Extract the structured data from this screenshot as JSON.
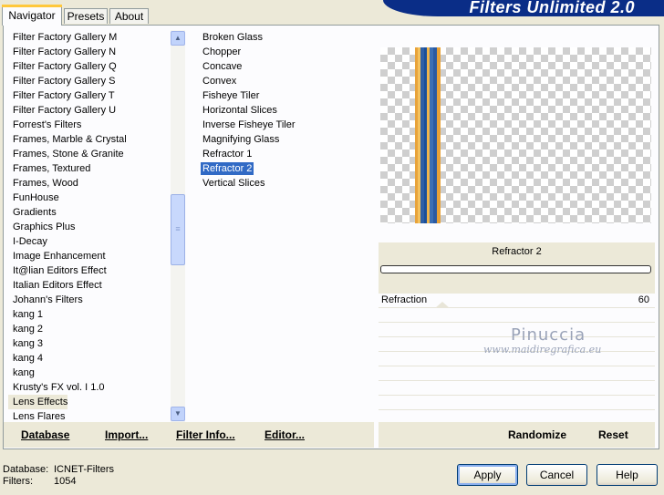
{
  "tabs": [
    "Navigator",
    "Presets",
    "About"
  ],
  "banner_title": "Filters Unlimited 2.0",
  "categories": [
    "Filter Factory Gallery M",
    "Filter Factory Gallery N",
    "Filter Factory Gallery Q",
    "Filter Factory Gallery S",
    "Filter Factory Gallery T",
    "Filter Factory Gallery U",
    "Forrest's Filters",
    "Frames, Marble & Crystal",
    "Frames, Stone & Granite",
    "Frames, Textured",
    "Frames, Wood",
    "FunHouse",
    "Gradients",
    "Graphics Plus",
    "I-Decay",
    "Image Enhancement",
    "It@lian Editors Effect",
    "Italian Editors Effect",
    "Johann's Filters",
    "kang 1",
    "kang 2",
    "kang 3",
    "kang 4",
    "kang",
    "Krusty's FX vol. I 1.0",
    "Lens Effects",
    "Lens Flares"
  ],
  "selected_category": "Lens Effects",
  "filters": [
    "Broken Glass",
    "Chopper",
    "Concave",
    "Convex",
    "Fisheye Tiler",
    "Horizontal Slices",
    "Inverse Fisheye Tiler",
    "Magnifying Glass",
    "Refractor 1",
    "Refractor 2",
    "Vertical Slices"
  ],
  "selected_filter": "Refractor 2",
  "preview": {
    "stripe_colors": [
      "#e8a33a",
      "#f4c25e",
      "#2e5fa6",
      "#1a4f9a",
      "#f0b54c",
      "#3b6fb5",
      "#2a5aa2",
      "#e7a137"
    ]
  },
  "filter_name": "Refractor 2",
  "progress": 0,
  "parameter": {
    "label": "Refraction",
    "value": "60"
  },
  "watermark": {
    "name": "Pinuccia",
    "site": "www.maidiregrafica.eu"
  },
  "left_buttons": {
    "database": "Database",
    "import": "Import...",
    "filter_info": "Filter Info...",
    "editor": "Editor..."
  },
  "right_buttons": {
    "randomize": "Randomize",
    "reset": "Reset"
  },
  "status": {
    "database_label": "Database:",
    "database_value": "ICNET-Filters",
    "filters_label": "Filters:",
    "filters_value": "1054"
  },
  "dialog_buttons": {
    "apply": "Apply",
    "cancel": "Cancel",
    "help": "Help"
  },
  "scroll_icons": {
    "up": "scroll-up-arrow-icon",
    "down": "scroll-down-arrow-icon"
  }
}
